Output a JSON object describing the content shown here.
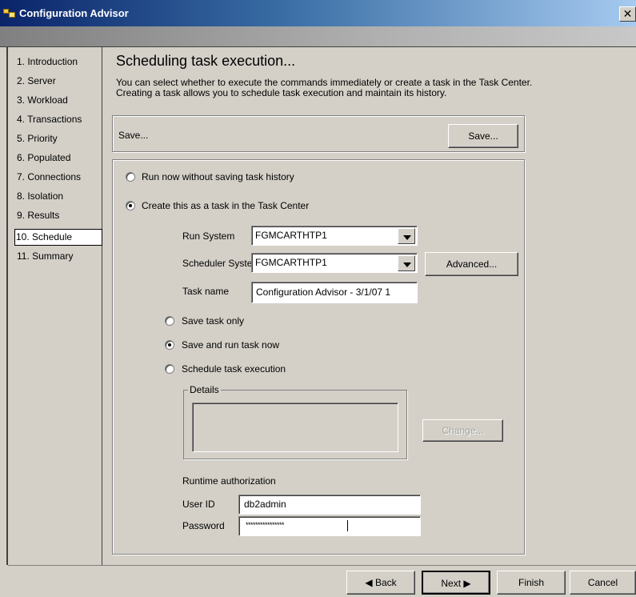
{
  "window": {
    "title": "Configuration Advisor",
    "close_glyph": "✕"
  },
  "sidebar": {
    "items": [
      {
        "label": "1. Introduction"
      },
      {
        "label": "2. Server"
      },
      {
        "label": "3. Workload"
      },
      {
        "label": "4. Transactions"
      },
      {
        "label": "5. Priority"
      },
      {
        "label": "6. Populated"
      },
      {
        "label": "7. Connections"
      },
      {
        "label": "8. Isolation"
      },
      {
        "label": "9. Results"
      },
      {
        "label": "10. Schedule",
        "selected": true
      },
      {
        "label": "11. Summary"
      }
    ]
  },
  "page": {
    "heading": "Scheduling task execution...",
    "description_line1": "You can select whether to execute the commands immediately or create a task in the Task Center.",
    "description_line2": "Creating a task allows you to schedule task execution and maintain its history."
  },
  "save_panel": {
    "label": "Save...",
    "button_label": "Save..."
  },
  "options": {
    "run_now_label": "Run now without saving task history",
    "run_now_selected": false,
    "create_task_label": "Create this as a task in the Task Center",
    "create_task_selected": true
  },
  "task": {
    "run_system_label": "Run System",
    "run_system_value": "FGMCARTHTP1",
    "scheduler_system_label": "Scheduler System",
    "scheduler_system_value": "FGMCARTHTP1",
    "advanced_button": "Advanced...",
    "task_name_label": "Task name",
    "task_name_value": "Configuration Advisor - 3/1/07 1",
    "save_only_label": "Save task only",
    "save_and_run_label": "Save and run task now",
    "schedule_label": "Schedule task execution",
    "selected_mode": "Save and run task now",
    "details_label": "Details",
    "change_button": "Change..."
  },
  "auth": {
    "heading": "Runtime authorization",
    "user_id_label": "User ID",
    "user_id_value": "db2admin",
    "password_label": "Password",
    "password_value": "****************"
  },
  "footer": {
    "back_label": "◀ Back",
    "next_label": "Next ▶",
    "finish_label": "Finish",
    "cancel_label": "Cancel"
  }
}
